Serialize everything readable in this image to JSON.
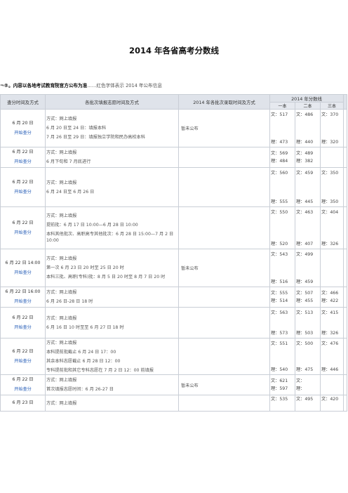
{
  "page": {
    "title": "2014 年各省高考分数线",
    "note_bold": "¬®。内容以各地考试教育院官方公布为准",
    "note_rest": "……红色字体表示 2014 年公布信息"
  },
  "table": {
    "headers": {
      "col1": "查分时间及方式",
      "col2": "各批次填报志愿时间及方式",
      "col3": "2014 年各批次录取时间及方式",
      "score": "2014 年分数线",
      "b1": "一本",
      "b2": "二本",
      "b3": "三本"
    },
    "rows": [
      {
        "time": "6 月 20 日",
        "link": "开始查分",
        "fill": [
          "方式：网上填报",
          "6 月 20 日至 24 日：填报本科",
          "7 月 26 日至 29 日：填报独立学院和民办高校本科"
        ],
        "admit": "暂未公布",
        "s1": [
          "文：517",
          "理：473"
        ],
        "s2": [
          "文：486",
          "理：440"
        ],
        "s3": [
          "文：370",
          "理：320"
        ]
      },
      {
        "time": "6 月 22 日",
        "link": "开始查分",
        "fill": [
          "方式：网上填报",
          "6 月下旬和 7 月底进行"
        ],
        "admit": "",
        "s1": [
          "文：569",
          "理：484"
        ],
        "s2": [
          "文：489",
          "理：382"
        ],
        "s3": [
          "",
          ""
        ]
      },
      {
        "time": "6 月 22 日",
        "link": "开始查分",
        "fill": [
          "方式：网上填报",
          "6 月 24 日至 6 月 26 日"
        ],
        "admit": "",
        "s1": [
          "文：560",
          "理：555"
        ],
        "s2": [
          "文：459",
          "理：445"
        ],
        "s3": [
          "文：350",
          "理：350"
        ]
      },
      {
        "time": "6 月 22 日",
        "link": "开始查分",
        "fill": [
          "方式：网上填报",
          "提前批：6 月 17 日 10:00—6 月 28 日 10:00",
          "本科其他批次、高职高专其他批次：6 月 28 日 15:00—7 月 2 日 10:00"
        ],
        "admit": "",
        "s1": [
          "文：550",
          "理：520"
        ],
        "s2": [
          "文：463",
          "理：407"
        ],
        "s3": [
          "文：404",
          "理：326"
        ]
      },
      {
        "time": "6 月 22 日 14:00",
        "link": "开始查分",
        "fill": [
          "方式：网上填报",
          "第一次 6 月 23 日 20 时至 25 日 20 时",
          "本科三批、高职(专科)批：8 月 5 日 20 时至 8 月 7 日 20 时"
        ],
        "admit": "暂未公布",
        "s1": [
          "文：543",
          "理：516"
        ],
        "s2": [
          "文：499",
          "理：459"
        ],
        "s3": [
          "",
          ""
        ]
      },
      {
        "time": "6 月 22 日 16:00",
        "link": "开始查分",
        "fill": [
          "方式：网上填报",
          "6 月 26 日-28 日 18 时"
        ],
        "admit": "",
        "s1": [
          "文：555",
          "理：514"
        ],
        "s2": [
          "文：507",
          "理：455"
        ],
        "s3": [
          "文：466",
          "理：422"
        ]
      },
      {
        "time": "6 月 22 日",
        "link": "开始查分",
        "fill": [
          "方式：网上填报",
          "6 月 16 日 10 时至至 6 月 27 日 18 时"
        ],
        "admit": "",
        "s1": [
          "文：563",
          "理：573"
        ],
        "s2": [
          "文：513",
          "理：503"
        ],
        "s3": [
          "文：415",
          "理：326"
        ]
      },
      {
        "time": "6 月 22 日",
        "link": "开始查分",
        "fill": [
          "方式：网上填报",
          "本科提前批截止 6 月 24 日 17：00",
          "其余本科志愿截止 6 月 28 日 12：00",
          "专科提前批和其它专科志愿在 7 月 2 日 12：00 前填报"
        ],
        "admit": "",
        "s1": [
          "文：551",
          "理：540"
        ],
        "s2": [
          "文：500",
          "理：475"
        ],
        "s3": [
          "文：476",
          "理：446"
        ]
      },
      {
        "time": "6 月 22 日",
        "link": "开始查分",
        "fill": [
          "方式：网上填报",
          "首次填报志愿时间：6 月 26-27 日"
        ],
        "admit": "暂未公布",
        "s1": [
          "文：621",
          "理：597"
        ],
        "s2": [
          "文：",
          "理："
        ],
        "s3": [
          "",
          ""
        ]
      },
      {
        "time": "6 月 23 日",
        "link": "",
        "fill": [
          "方式：网上填报"
        ],
        "admit": "",
        "s1": [
          "文：535",
          ""
        ],
        "s2": [
          "文：495",
          ""
        ],
        "s3": [
          "文：420",
          ""
        ]
      }
    ]
  }
}
